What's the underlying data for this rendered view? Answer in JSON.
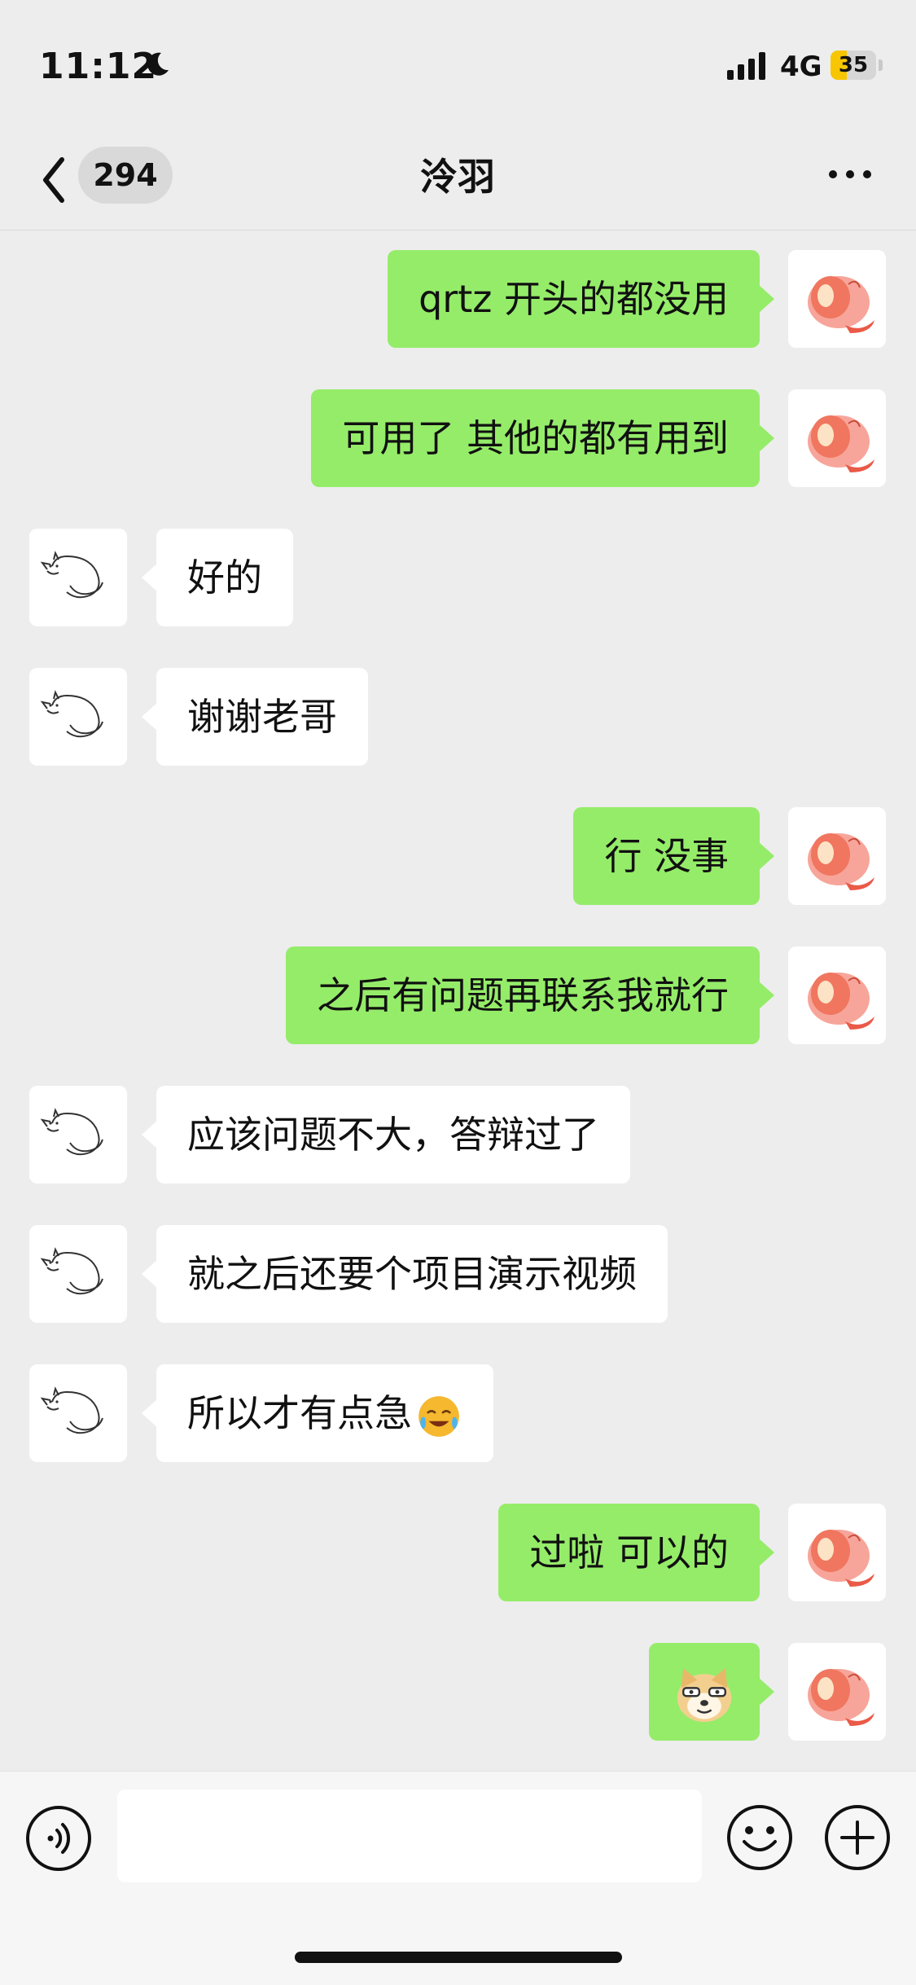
{
  "status_bar": {
    "time": "11:12",
    "network": "4G",
    "battery": "35",
    "battery_percent": 35
  },
  "nav": {
    "back_count": "294",
    "title": "泠羽"
  },
  "messages": [
    {
      "side": "right",
      "text": "qrtz 开头的都没用"
    },
    {
      "side": "right",
      "text": "可用了 其他的都有用到"
    },
    {
      "side": "left",
      "text": "好的"
    },
    {
      "side": "left",
      "text": "谢谢老哥"
    },
    {
      "side": "right",
      "text": "行 没事"
    },
    {
      "side": "right",
      "text": "之后有问题再联系我就行"
    },
    {
      "side": "left",
      "text": "应该问题不大，答辩过了"
    },
    {
      "side": "left",
      "text": "就之后还要个项目演示视频"
    },
    {
      "side": "left",
      "text": "所以才有点急",
      "emoji": "crying-laughing-emoji"
    },
    {
      "side": "right",
      "text": "过啦 可以的"
    },
    {
      "side": "right",
      "sticker": "doge-sticker"
    }
  ],
  "input": {
    "value": "",
    "placeholder": ""
  },
  "colors": {
    "background": "#ededed",
    "sent_bubble": "#95ec69",
    "received_bubble": "#ffffff",
    "battery_fill": "#f7c600"
  },
  "icons": {
    "back": "chevron-left-icon",
    "more": "more-icon",
    "voice": "voice-icon",
    "emoji": "emoji-icon",
    "plus": "plus-icon",
    "peach_avatar": "peach-avatar",
    "cat_avatar": "cat-sketch-avatar"
  }
}
